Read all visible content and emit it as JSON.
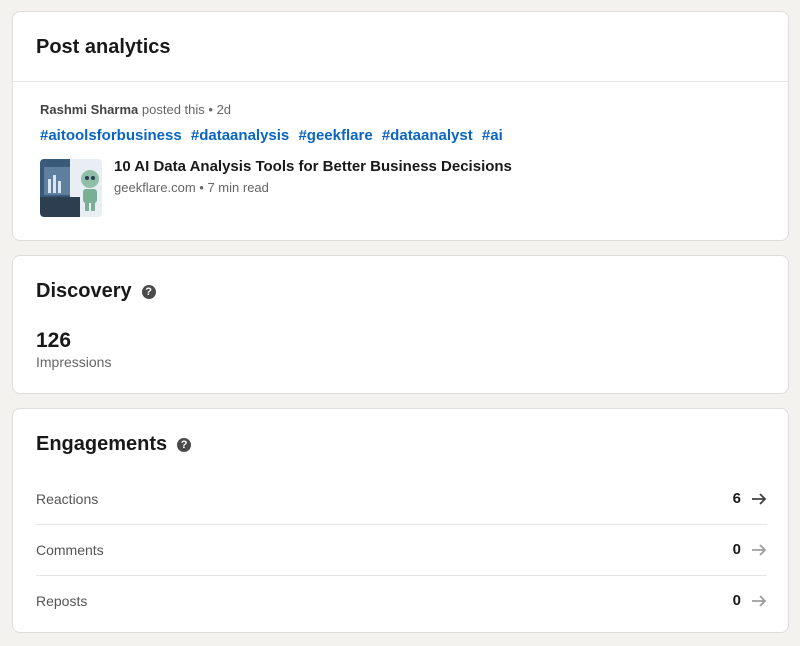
{
  "post": {
    "title": "Post analytics",
    "author": "Rashmi Sharma",
    "author_suffix": "posted this",
    "separator": "•",
    "age": "2d",
    "hashtags": [
      "#aitoolsforbusiness",
      "#dataanalysis",
      "#geekflare",
      "#dataanalyst",
      "#ai"
    ],
    "article": {
      "title": "10 AI Data Analysis Tools for Better Business Decisions",
      "source": "geekflare.com",
      "read_time": "7 min read"
    }
  },
  "discovery": {
    "title": "Discovery",
    "help_icon": "question-circle-icon",
    "impressions_value": "126",
    "impressions_label": "Impressions"
  },
  "engagements": {
    "title": "Engagements",
    "help_icon": "question-circle-icon",
    "rows": [
      {
        "label": "Reactions",
        "count": "6",
        "arrow_color": "#404040"
      },
      {
        "label": "Comments",
        "count": "0",
        "arrow_color": "#9e9e9e"
      },
      {
        "label": "Reposts",
        "count": "0",
        "arrow_color": "#9e9e9e"
      }
    ]
  },
  "colors": {
    "hashtag": "#0a66c2",
    "background": "#f4f2ee"
  }
}
